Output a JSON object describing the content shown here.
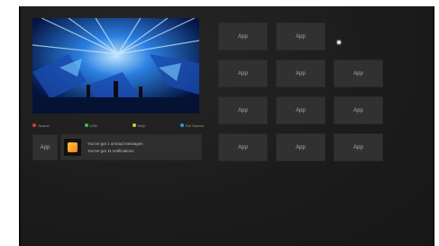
{
  "legend": {
    "items": [
      {
        "label": "Search",
        "color": "#d23a3a"
      },
      {
        "label": "USB",
        "color": "#3bbf45"
      },
      {
        "label": "Help",
        "color": "#d8c437"
      },
      {
        "label": "Full Screen",
        "color": "#3b8fd8"
      }
    ]
  },
  "apps": {
    "label": "App"
  },
  "notification": {
    "line1": "You've got 1 unread messages",
    "line2": "You've got 11 notifications"
  },
  "colors": {
    "background": "#1b1b1b",
    "tile": "#313131",
    "text": "#a9a9a9"
  },
  "icons": {
    "notification": "app-badge-icon",
    "cursor": "pointer-icon"
  }
}
